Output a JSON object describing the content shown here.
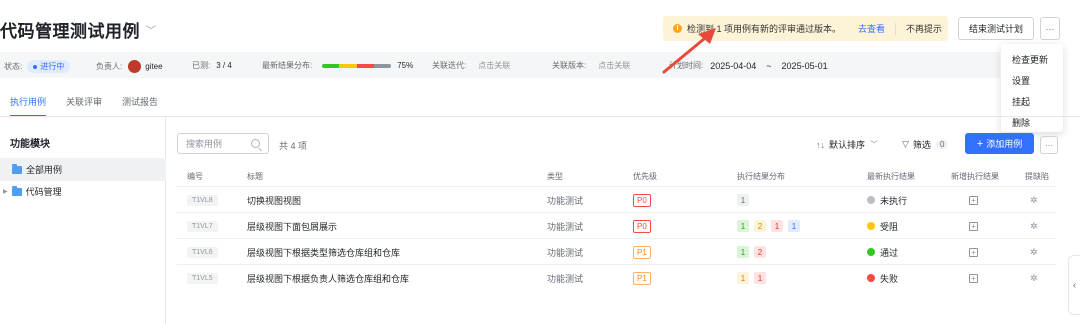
{
  "header": {
    "title": "代码管理测试用例",
    "notice_text": "检测到 1 项用例有新的评审通过版本。",
    "notice_link": "去查看",
    "notice_dismiss": "不再提示",
    "end_button": "结束测试计划",
    "more_label": "···"
  },
  "menu": {
    "items": [
      "检查更新",
      "设置",
      "挂起",
      "删除"
    ]
  },
  "info": {
    "status_label": "状态:",
    "status_value": "进行中",
    "owner_label": "负责人:",
    "owner_name": "gitee",
    "tested_label": "已测:",
    "tested_value": "3 / 4",
    "dist_label": "最新结果分布:",
    "dist_percent": "75%",
    "dist_segments": [
      {
        "color": "#34c724",
        "fraction": 0.25
      },
      {
        "color": "#ffc60a",
        "fraction": 0.25
      },
      {
        "color": "#f54a45",
        "fraction": 0.25
      },
      {
        "color": "#8f959e",
        "fraction": 0.25
      }
    ],
    "iteration_label": "关联迭代:",
    "iteration_value": "点击关联",
    "version_label": "关联版本:",
    "version_value": "点击关联",
    "plan_time_label": "计划时间:",
    "start_date": "2025-04-04",
    "date_sep": "~",
    "end_date": "2025-05-01"
  },
  "tabs": [
    "执行用例",
    "关联评审",
    "测试报告"
  ],
  "sidebar": {
    "title": "功能模块",
    "items": [
      "全部用例",
      "代码管理"
    ]
  },
  "toolbar": {
    "search_placeholder": "搜索用例",
    "count": "共 4 项",
    "sort": "默认排序",
    "filter": "筛选",
    "filter_count": "0",
    "add_button": "添加用例"
  },
  "table": {
    "headers": [
      "编号",
      "标题",
      "类型",
      "优先级",
      "执行结果分布",
      "最新执行结果",
      "新增执行结果",
      "提缺陷"
    ],
    "rows": [
      {
        "id": "T1VL8",
        "title": "切换视图视图",
        "type": "功能测试",
        "priority": "P0",
        "chips": [
          {
            "v": "1",
            "bg": "#eff0f1",
            "fg": "#646a73"
          }
        ],
        "result": "未执行",
        "result_color": "#bbbfc4"
      },
      {
        "id": "T1VL7",
        "title": "层级视图下面包屑展示",
        "type": "功能测试",
        "priority": "P0",
        "chips": [
          {
            "v": "1",
            "bg": "#d9f5d6",
            "fg": "#2ea121"
          },
          {
            "v": "2",
            "bg": "#fdf3d7",
            "fg": "#d88500"
          },
          {
            "v": "1",
            "bg": "#fde2e2",
            "fg": "#d83931"
          },
          {
            "v": "1",
            "bg": "#e1eaff",
            "fg": "#3370ff"
          }
        ],
        "result": "受阻",
        "result_color": "#ffc60a"
      },
      {
        "id": "T1VL6",
        "title": "层级视图下根据类型筛选仓库组和仓库",
        "type": "功能测试",
        "priority": "P1",
        "chips": [
          {
            "v": "1",
            "bg": "#d9f5d6",
            "fg": "#2ea121"
          },
          {
            "v": "2",
            "bg": "#fde2e2",
            "fg": "#d83931"
          }
        ],
        "result": "通过",
        "result_color": "#34c724"
      },
      {
        "id": "T1VL5",
        "title": "层级视图下根据负责人筛选仓库组和仓库",
        "type": "功能测试",
        "priority": "P1",
        "chips": [
          {
            "v": "1",
            "bg": "#fdf3d7",
            "fg": "#d88500"
          },
          {
            "v": "1",
            "bg": "#fde2e2",
            "fg": "#d83931"
          }
        ],
        "result": "失败",
        "result_color": "#f54a45"
      }
    ]
  }
}
